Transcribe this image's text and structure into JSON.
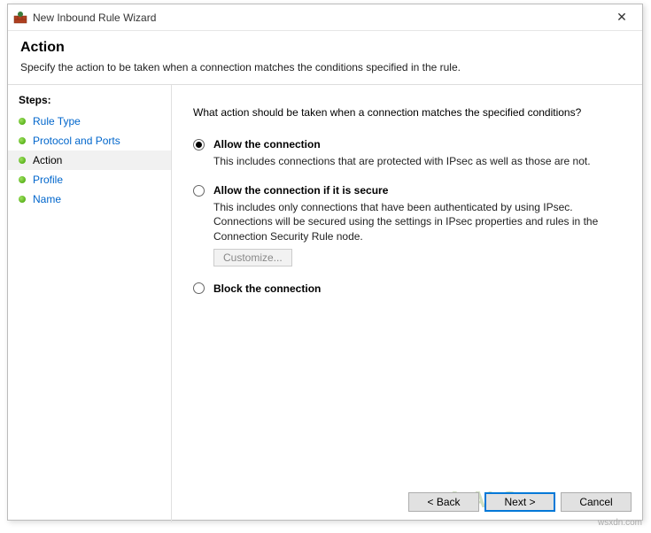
{
  "window": {
    "title": "New Inbound Rule Wizard",
    "close_glyph": "✕"
  },
  "header": {
    "title": "Action",
    "subtitle": "Specify the action to be taken when a connection matches the conditions specified in the rule."
  },
  "sidebar": {
    "steps_label": "Steps:",
    "items": [
      {
        "label": "Rule Type",
        "active": false
      },
      {
        "label": "Protocol and Ports",
        "active": false
      },
      {
        "label": "Action",
        "active": true
      },
      {
        "label": "Profile",
        "active": false
      },
      {
        "label": "Name",
        "active": false
      }
    ]
  },
  "content": {
    "prompt": "What action should be taken when a connection matches the specified conditions?",
    "options": [
      {
        "title": "Allow the connection",
        "desc": "This includes connections that are protected with IPsec as well as those are not.",
        "selected": true
      },
      {
        "title": "Allow the connection if it is secure",
        "desc": "This includes only connections that have been authenticated by using IPsec. Connections will be secured using the settings in IPsec properties and rules in the Connection Security Rule node.",
        "selected": false,
        "customize_label": "Customize..."
      },
      {
        "title": "Block the connection",
        "desc": "",
        "selected": false
      }
    ]
  },
  "footer": {
    "back": "< Back",
    "next": "Next >",
    "cancel": "Cancel"
  },
  "watermark": "wsxdn.com",
  "logo_watermark": "A   ALS"
}
